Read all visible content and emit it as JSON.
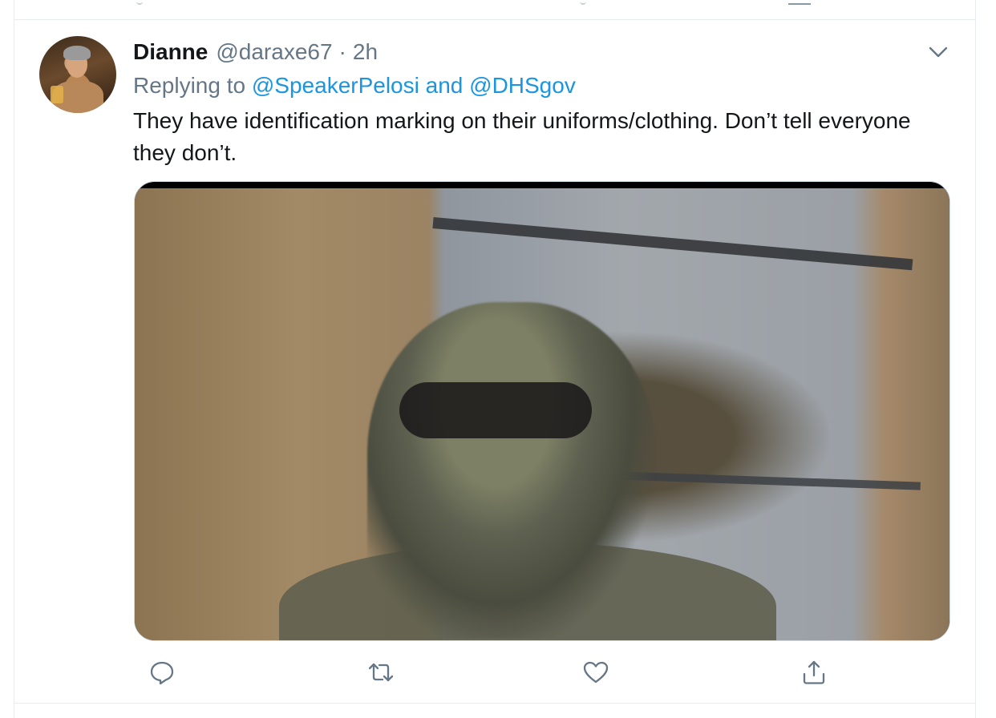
{
  "tweet": {
    "display_name": "Dianne",
    "handle": "@daraxe67",
    "separator": "·",
    "time": "2h",
    "replying_prefix": "Replying to",
    "replying_to_1": "@SpeakerPelosi",
    "replying_and": "and",
    "replying_to_2": "@DHSgov",
    "text": "They have identification marking on their uniforms/clothing. Don’t tell everyone they don’t."
  },
  "icons": {
    "menu": "chevron-down-icon",
    "reply": "reply-icon",
    "retweet": "retweet-icon",
    "like": "heart-icon",
    "share": "share-icon"
  },
  "colors": {
    "link": "#1b95e0",
    "secondary_text": "#657786",
    "primary_text": "#14171a",
    "border": "#e6ecf0"
  }
}
